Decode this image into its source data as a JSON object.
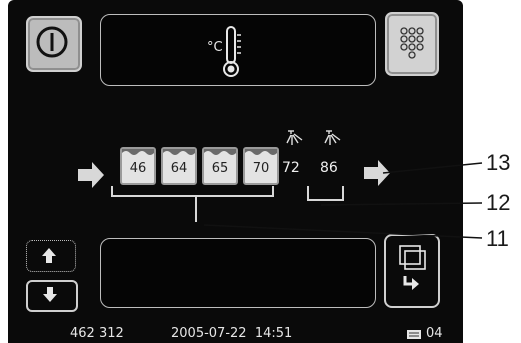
{
  "tanks": [
    {
      "value": "46"
    },
    {
      "value": "64"
    },
    {
      "value": "65"
    },
    {
      "value": "70"
    }
  ],
  "rinse_zones": [
    {
      "value": "72"
    },
    {
      "value": "86"
    }
  ],
  "status": {
    "serial": "462 312",
    "datetime": "2005-07-22  14:51",
    "page": "04"
  },
  "callouts": [
    "13",
    "12",
    "11"
  ],
  "icons": {
    "power": "power-icon",
    "thermometer": "thermometer-icon",
    "keypad": "keypad-icon",
    "up": "arrow-up-icon",
    "down": "arrow-down-icon",
    "windows": "windows-icon",
    "flow_in": "arrow-right-icon",
    "flow_out": "arrow-right-icon",
    "page": "page-icon"
  },
  "temp_unit": "°C"
}
